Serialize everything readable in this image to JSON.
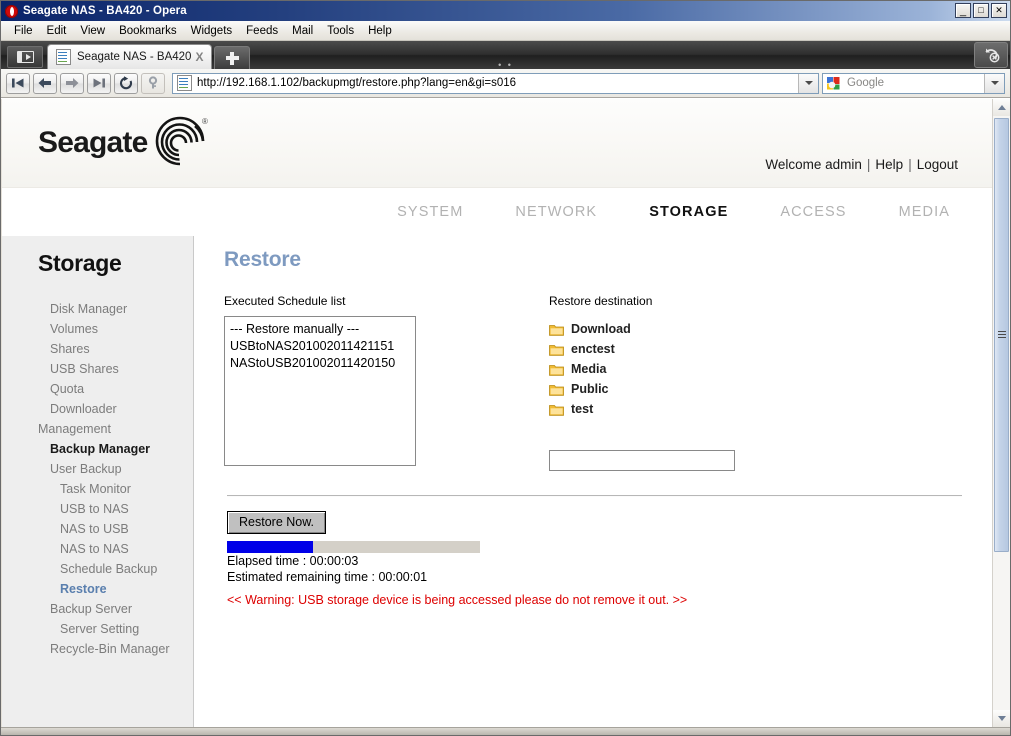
{
  "window": {
    "title": "Seagate NAS - BA420 - Opera",
    "minimize": "_",
    "maximize": "□",
    "close": "✕"
  },
  "menubar": {
    "items": [
      "File",
      "Edit",
      "View",
      "Bookmarks",
      "Widgets",
      "Feeds",
      "Mail",
      "Tools",
      "Help"
    ]
  },
  "tabbar": {
    "tab_title": "Seagate NAS - BA420",
    "close_label": "X",
    "dots": "• •"
  },
  "addressbar": {
    "url": "http://192.168.1.102/backupmgt/restore.php?lang=en&gi=s016",
    "search_placeholder": "Google"
  },
  "site": {
    "logo_word": "Seagate",
    "welcome": "Welcome admin",
    "help": "Help",
    "logout": "Logout",
    "separator": "|"
  },
  "topnav": {
    "items": [
      {
        "label": "SYSTEM",
        "active": false
      },
      {
        "label": "NETWORK",
        "active": false
      },
      {
        "label": "STORAGE",
        "active": true
      },
      {
        "label": "ACCESS",
        "active": false
      },
      {
        "label": "MEDIA",
        "active": false
      }
    ]
  },
  "sidebar": {
    "title": "Storage",
    "items": [
      {
        "label": "Disk Manager",
        "level": 1,
        "state": "normal"
      },
      {
        "label": "Volumes",
        "level": 1,
        "state": "normal"
      },
      {
        "label": "Shares",
        "level": 1,
        "state": "normal"
      },
      {
        "label": "USB Shares",
        "level": 1,
        "state": "normal"
      },
      {
        "label": "Quota",
        "level": 1,
        "state": "normal"
      },
      {
        "label": "Downloader",
        "level": 1,
        "state": "normal"
      },
      {
        "label": "Management",
        "level": 0,
        "state": "normal"
      },
      {
        "label": "Backup Manager",
        "level": 1,
        "state": "bold"
      },
      {
        "label": "User Backup",
        "level": 1,
        "state": "normal"
      },
      {
        "label": "Task Monitor",
        "level": 2,
        "state": "normal"
      },
      {
        "label": "USB to NAS",
        "level": 2,
        "state": "normal"
      },
      {
        "label": "NAS to USB",
        "level": 2,
        "state": "normal"
      },
      {
        "label": "NAS to NAS",
        "level": 2,
        "state": "normal"
      },
      {
        "label": "Schedule Backup",
        "level": 2,
        "state": "normal"
      },
      {
        "label": "Restore",
        "level": 2,
        "state": "selected"
      },
      {
        "label": "Backup Server",
        "level": 1,
        "state": "normal"
      },
      {
        "label": "Server Setting",
        "level": 2,
        "state": "normal"
      },
      {
        "label": "Recycle-Bin Manager",
        "level": 1,
        "state": "normal"
      }
    ]
  },
  "main": {
    "page_title": "Restore",
    "schedule_list": {
      "label": "Executed Schedule list",
      "options": [
        "--- Restore manually ---",
        "USBtoNAS201002011421151",
        "NAStoUSB201002011420150"
      ]
    },
    "destination": {
      "label": "Restore destination",
      "folders": [
        "Download",
        "enctest",
        "Media",
        "Public",
        "test"
      ],
      "input_value": ""
    },
    "restore_button": "Restore Now.",
    "progress": {
      "percent": 34,
      "elapsed": "Elapsed time : 00:00:03",
      "remaining": "Estimated remaining time : 00:00:01"
    },
    "warning": "<< Warning: USB storage device is being accessed please do not remove it out. >>"
  },
  "colors": {
    "title_accent": "#7e9ac0",
    "selected_nav": "#5a7fae",
    "warning": "#dd0000",
    "progress_fill": "#0000e8",
    "folder": "#f2c43d"
  }
}
